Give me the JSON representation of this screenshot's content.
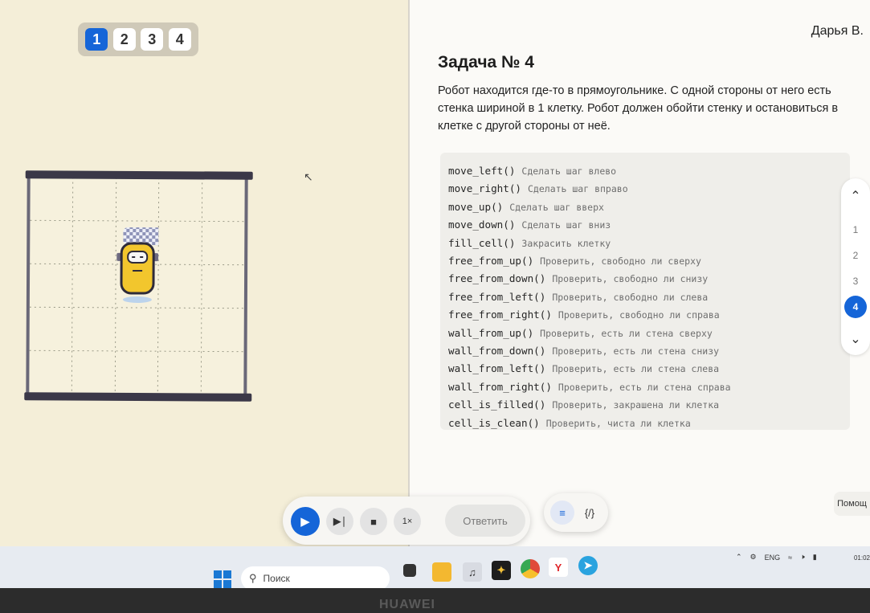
{
  "task_tabs": [
    "1",
    "2",
    "3",
    "4"
  ],
  "user": {
    "name": "Дарья В."
  },
  "task": {
    "title": "Задача № 4",
    "description": "Робот находится где-то в прямоугольнике. С одной стороны от него есть стенка шириной в 1 клетку. Робот должен обойти стенку и остановиться в клетке с другой стороны от неё."
  },
  "commands": [
    {
      "fn": "move_left()",
      "desc": "Сделать шаг влево"
    },
    {
      "fn": "move_right()",
      "desc": "Сделать шаг вправо"
    },
    {
      "fn": "move_up()",
      "desc": "Сделать шаг вверх"
    },
    {
      "fn": "move_down()",
      "desc": "Сделать шаг вниз"
    },
    {
      "fn": "fill_cell()",
      "desc": "Закрасить клетку"
    },
    {
      "fn": "free_from_up()",
      "desc": "Проверить, свободно ли сверху"
    },
    {
      "fn": "free_from_down()",
      "desc": "Проверить, свободно ли снизу"
    },
    {
      "fn": "free_from_left()",
      "desc": "Проверить, свободно ли слева"
    },
    {
      "fn": "free_from_right()",
      "desc": "Проверить, свободно ли справа"
    },
    {
      "fn": "wall_from_up()",
      "desc": "Проверить, есть ли стена сверху"
    },
    {
      "fn": "wall_from_down()",
      "desc": "Проверить, есть ли стена снизу"
    },
    {
      "fn": "wall_from_left()",
      "desc": "Проверить, есть ли стена слева"
    },
    {
      "fn": "wall_from_right()",
      "desc": "Проверить, есть ли стена справа"
    },
    {
      "fn": "cell_is_filled()",
      "desc": "Проверить, закрашена ли клетка"
    },
    {
      "fn": "cell_is_clean()",
      "desc": "Проверить, чиста ли клетка"
    }
  ],
  "task_nav": [
    "1",
    "2",
    "3",
    "4"
  ],
  "controls": {
    "speed": "1×",
    "answer": "Ответить"
  },
  "help": "Помощ",
  "taskbar": {
    "search": "Поиск",
    "lang": "ENG",
    "time": "01:02"
  },
  "brand": "HUAWEI",
  "colors": {
    "accent": "#1565d8",
    "wall": "#3b3848",
    "robot": "#f2c62d"
  }
}
